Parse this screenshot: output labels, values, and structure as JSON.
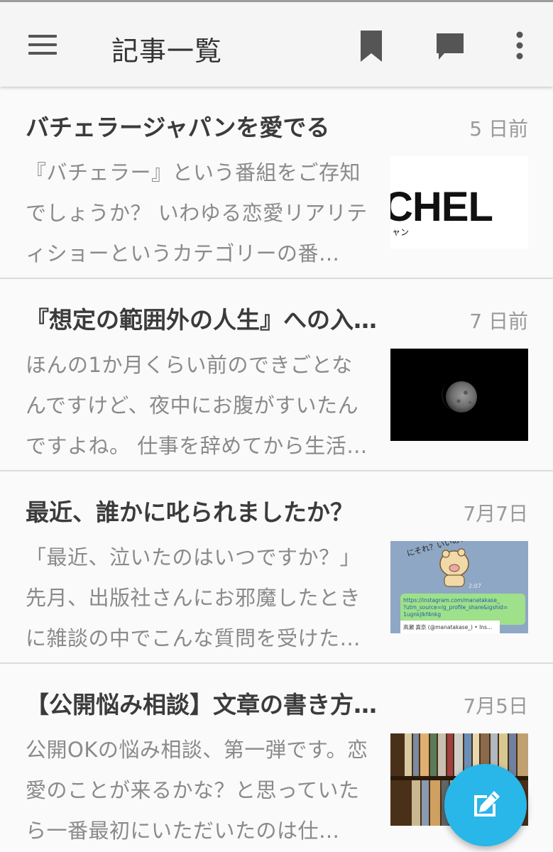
{
  "app_bar": {
    "title": "記事一覧",
    "menu_icon": "hamburger-menu-icon",
    "actions": [
      "bookmark-icon",
      "comment-icon",
      "more-vertical-icon"
    ]
  },
  "articles": [
    {
      "title": "バチェラージャパンを愛でる",
      "date": "5 日前",
      "excerpt": "『バチェラー』という番組をご存知でしょうか？ いわゆる恋愛リアリティショーというカテゴリーの番…",
      "thumbnail_text": "CHEL",
      "thumbnail_subtext": "ャン"
    },
    {
      "title": "『想定の範囲外の人生』への入…",
      "date": "7 日前",
      "excerpt": "ほんの1か月くらい前のできごとなんですけど、夜中にお腹がすいたんですよね。 仕事を辞めてから生活…"
    },
    {
      "title": "最近、誰かに叱られましたか？",
      "date": "7月7日",
      "excerpt": "「最近、泣いたのはいつですか？」先月、出版社さんにお邪魔したときに雑談の中でこんな質問を受けた…",
      "thumbnail_texts": {
        "bubble": "にそれ？いいの？",
        "time": "2:07",
        "link": "https://instagram.com/manatakase_?utm_source=ig_profile_share&igshid=1ugnkjlkf4nkg",
        "caption": "高瀬 真奈 (@manatakase_) • Ins..."
      }
    },
    {
      "title": "【公開悩み相談】文章の書き方…",
      "date": "7月5日",
      "excerpt": "公開OKの悩み相談、第一弾です。恋愛のことが来るかな？と思っていたら一番最初にいただいたのは仕…"
    }
  ],
  "fab": {
    "icon": "edit-icon"
  },
  "colors": {
    "accent": "#29b6e8",
    "title_text": "#3b3b3b",
    "muted_text": "#8a8a8a"
  }
}
